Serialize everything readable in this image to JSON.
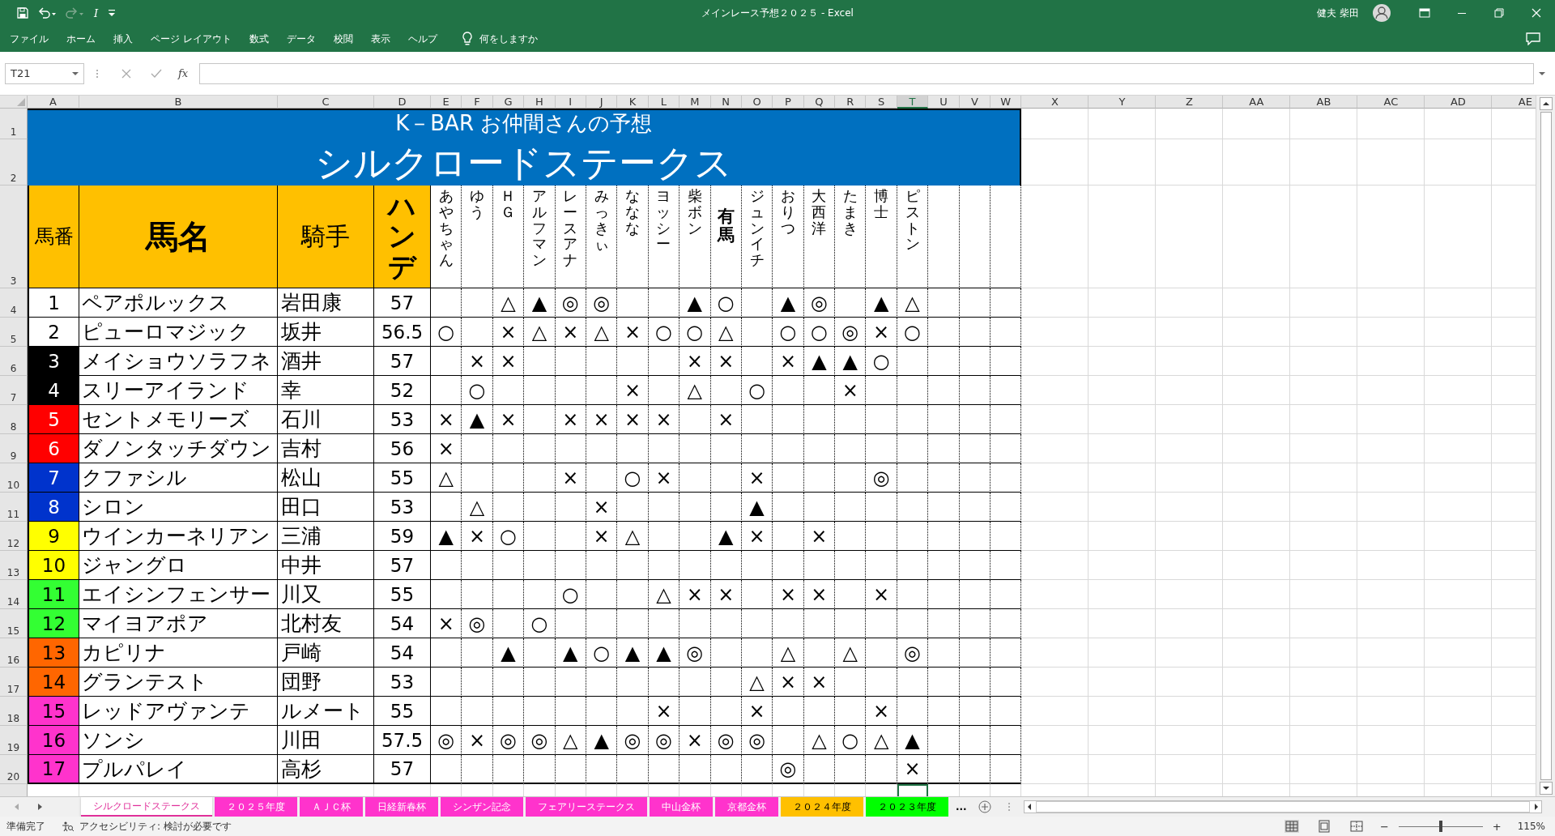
{
  "title_bar": {
    "quick_access": [
      {
        "kind": "save",
        "disabled": false
      },
      {
        "kind": "undo",
        "disabled": false
      },
      {
        "kind": "redo",
        "disabled": true
      },
      {
        "kind": "italic",
        "label": "I",
        "disabled": false
      },
      {
        "kind": "customize",
        "disabled": false
      }
    ],
    "title": "メインレース予想２０２５  -  Excel",
    "user": "健夫 柴田"
  },
  "ribbon_tabs": [
    "ファイル",
    "ホーム",
    "挿入",
    "ページ レイアウト",
    "数式",
    "データ",
    "校閲",
    "表示",
    "ヘルプ"
  ],
  "tell_me": "何をしますか",
  "formula_bar": {
    "name_box": "T21",
    "function_label": "fx"
  },
  "columns": [
    {
      "label": "A",
      "selected": false
    },
    {
      "label": "B",
      "selected": false
    },
    {
      "label": "C",
      "selected": false
    },
    {
      "label": "D",
      "selected": false
    },
    {
      "label": "E",
      "selected": false
    },
    {
      "label": "F",
      "selected": false
    },
    {
      "label": "G",
      "selected": false
    },
    {
      "label": "H",
      "selected": false
    },
    {
      "label": "I",
      "selected": false
    },
    {
      "label": "J",
      "selected": false
    },
    {
      "label": "K",
      "selected": false
    },
    {
      "label": "L",
      "selected": false
    },
    {
      "label": "M",
      "selected": false
    },
    {
      "label": "N",
      "selected": false
    },
    {
      "label": "O",
      "selected": false
    },
    {
      "label": "P",
      "selected": false
    },
    {
      "label": "Q",
      "selected": false
    },
    {
      "label": "R",
      "selected": false
    },
    {
      "label": "S",
      "selected": false
    },
    {
      "label": "T",
      "selected": true
    },
    {
      "label": "U",
      "selected": false
    },
    {
      "label": "V",
      "selected": false
    },
    {
      "label": "W",
      "selected": false
    },
    {
      "label": "X",
      "selected": false
    },
    {
      "label": "Y",
      "selected": false
    },
    {
      "label": "Z",
      "selected": false
    },
    {
      "label": "AA",
      "selected": false
    },
    {
      "label": "AB",
      "selected": false
    },
    {
      "label": "AC",
      "selected": false
    },
    {
      "label": "AD",
      "selected": false
    },
    {
      "label": "AE",
      "selected": false
    }
  ],
  "row_headers": [
    "1",
    "2",
    "3",
    "4",
    "5",
    "6",
    "7",
    "8",
    "9",
    "10",
    "11",
    "12",
    "13",
    "14",
    "15",
    "16",
    "17",
    "18",
    "19",
    "20"
  ],
  "sheet": {
    "subtitle": "K－BAR  お仲間さんの予想",
    "title": "シルクロードステークス",
    "headers": [
      "馬番",
      "馬名",
      "騎手",
      "ハンデ"
    ],
    "forecasters": [
      {
        "name": "あやちゃん",
        "bold": false
      },
      {
        "name": "ゆう",
        "bold": false
      },
      {
        "name": "ＨＧ",
        "bold": false
      },
      {
        "name": "アルフマン",
        "bold": false
      },
      {
        "name": "レースアナ",
        "bold": false
      },
      {
        "name": "みっきぃ",
        "bold": false
      },
      {
        "name": "ななな",
        "bold": false
      },
      {
        "name": "ヨッシー",
        "bold": false
      },
      {
        "name": "柴ボン",
        "bold": false
      },
      {
        "name": "有馬",
        "bold": true
      },
      {
        "name": "ジュンイチ",
        "bold": false
      },
      {
        "name": "おりつ",
        "bold": false
      },
      {
        "name": "大西洋",
        "bold": false
      },
      {
        "name": "たまき",
        "bold": false
      },
      {
        "name": "博士",
        "bold": false
      },
      {
        "name": "ピストン",
        "bold": false
      }
    ],
    "rows": [
      {
        "number": "1",
        "color": "#ffffff",
        "name": "ペアポルックス",
        "jockey": "岩田康",
        "weight": "57",
        "marks": [
          {
            "kind": "empty"
          },
          {
            "kind": "empty"
          },
          {
            "kind": "mark",
            "text": "△"
          },
          {
            "kind": "mark",
            "text": "▲"
          },
          {
            "kind": "mark",
            "text": "◎"
          },
          {
            "kind": "mark",
            "text": "◎"
          },
          {
            "kind": "empty"
          },
          {
            "kind": "empty"
          },
          {
            "kind": "mark",
            "text": "▲"
          },
          {
            "kind": "mark",
            "text": "○"
          },
          {
            "kind": "empty"
          },
          {
            "kind": "mark",
            "text": "▲"
          },
          {
            "kind": "mark",
            "text": "◎"
          },
          {
            "kind": "empty"
          },
          {
            "kind": "mark",
            "text": "▲"
          },
          {
            "kind": "mark",
            "text": "△"
          }
        ]
      },
      {
        "number": "2",
        "color": "#ffffff",
        "name": "ピューロマジック",
        "jockey": "坂井",
        "weight": "56.5",
        "marks": [
          {
            "kind": "mark",
            "text": "○"
          },
          {
            "kind": "empty"
          },
          {
            "kind": "mark",
            "text": "×"
          },
          {
            "kind": "mark",
            "text": "△"
          },
          {
            "kind": "mark",
            "text": "×"
          },
          {
            "kind": "mark",
            "text": "△"
          },
          {
            "kind": "mark",
            "text": "×"
          },
          {
            "kind": "mark",
            "text": "○"
          },
          {
            "kind": "mark",
            "text": "○"
          },
          {
            "kind": "mark",
            "text": "△"
          },
          {
            "kind": "empty"
          },
          {
            "kind": "mark",
            "text": "○"
          },
          {
            "kind": "mark",
            "text": "○"
          },
          {
            "kind": "mark",
            "text": "◎"
          },
          {
            "kind": "mark",
            "text": "×"
          },
          {
            "kind": "mark",
            "text": "○"
          }
        ]
      },
      {
        "number": "3",
        "color": "#000000",
        "name": "メイショウソラフネ",
        "jockey": "酒井",
        "weight": "57",
        "marks": [
          {
            "kind": "empty"
          },
          {
            "kind": "mark",
            "text": "×"
          },
          {
            "kind": "mark",
            "text": "×"
          },
          {
            "kind": "empty"
          },
          {
            "kind": "empty"
          },
          {
            "kind": "empty"
          },
          {
            "kind": "empty"
          },
          {
            "kind": "empty"
          },
          {
            "kind": "mark",
            "text": "×"
          },
          {
            "kind": "mark",
            "text": "×"
          },
          {
            "kind": "empty"
          },
          {
            "kind": "mark",
            "text": "×"
          },
          {
            "kind": "mark",
            "text": "▲"
          },
          {
            "kind": "mark",
            "text": "▲"
          },
          {
            "kind": "mark",
            "text": "○"
          },
          {
            "kind": "empty"
          }
        ]
      },
      {
        "number": "4",
        "color": "#000000",
        "name": "スリーアイランド",
        "jockey": "幸",
        "weight": "52",
        "marks": [
          {
            "kind": "empty"
          },
          {
            "kind": "mark",
            "text": "○"
          },
          {
            "kind": "empty"
          },
          {
            "kind": "empty"
          },
          {
            "kind": "empty"
          },
          {
            "kind": "empty"
          },
          {
            "kind": "mark",
            "text": "×"
          },
          {
            "kind": "empty"
          },
          {
            "kind": "mark",
            "text": "△"
          },
          {
            "kind": "empty"
          },
          {
            "kind": "mark",
            "text": "○"
          },
          {
            "kind": "empty"
          },
          {
            "kind": "empty"
          },
          {
            "kind": "mark",
            "text": "×"
          },
          {
            "kind": "empty"
          },
          {
            "kind": "empty"
          }
        ]
      },
      {
        "number": "5",
        "color": "#ff0000",
        "name": "セントメモリーズ",
        "jockey": "石川",
        "weight": "53",
        "marks": [
          {
            "kind": "mark",
            "text": "×"
          },
          {
            "kind": "mark",
            "text": "▲"
          },
          {
            "kind": "mark",
            "text": "×"
          },
          {
            "kind": "empty"
          },
          {
            "kind": "mark",
            "text": "×"
          },
          {
            "kind": "mark",
            "text": "×"
          },
          {
            "kind": "mark",
            "text": "×"
          },
          {
            "kind": "mark",
            "text": "×"
          },
          {
            "kind": "empty"
          },
          {
            "kind": "mark",
            "text": "×"
          },
          {
            "kind": "empty"
          },
          {
            "kind": "empty"
          },
          {
            "kind": "empty"
          },
          {
            "kind": "empty"
          },
          {
            "kind": "empty"
          },
          {
            "kind": "empty"
          }
        ]
      },
      {
        "number": "6",
        "color": "#ff0000",
        "name": "ダノンタッチダウン",
        "jockey": "吉村",
        "weight": "56",
        "marks": [
          {
            "kind": "mark",
            "text": "×"
          },
          {
            "kind": "empty"
          },
          {
            "kind": "empty"
          },
          {
            "kind": "empty"
          },
          {
            "kind": "empty"
          },
          {
            "kind": "empty"
          },
          {
            "kind": "empty"
          },
          {
            "kind": "empty"
          },
          {
            "kind": "empty"
          },
          {
            "kind": "empty"
          },
          {
            "kind": "empty"
          },
          {
            "kind": "empty"
          },
          {
            "kind": "empty"
          },
          {
            "kind": "empty"
          },
          {
            "kind": "empty"
          },
          {
            "kind": "empty"
          }
        ]
      },
      {
        "number": "7",
        "color": "#0033cc",
        "name": "クファシル",
        "jockey": "松山",
        "weight": "55",
        "marks": [
          {
            "kind": "mark",
            "text": "△"
          },
          {
            "kind": "empty"
          },
          {
            "kind": "empty"
          },
          {
            "kind": "empty"
          },
          {
            "kind": "mark",
            "text": "×"
          },
          {
            "kind": "empty"
          },
          {
            "kind": "mark",
            "text": "○"
          },
          {
            "kind": "mark",
            "text": "×"
          },
          {
            "kind": "empty"
          },
          {
            "kind": "empty"
          },
          {
            "kind": "mark",
            "text": "×"
          },
          {
            "kind": "empty"
          },
          {
            "kind": "empty"
          },
          {
            "kind": "empty"
          },
          {
            "kind": "mark",
            "text": "◎"
          },
          {
            "kind": "empty"
          }
        ]
      },
      {
        "number": "8",
        "color": "#0033cc",
        "name": "シロン",
        "jockey": "田口",
        "weight": "53",
        "marks": [
          {
            "kind": "empty"
          },
          {
            "kind": "mark",
            "text": "△"
          },
          {
            "kind": "empty"
          },
          {
            "kind": "empty"
          },
          {
            "kind": "empty"
          },
          {
            "kind": "mark",
            "text": "×"
          },
          {
            "kind": "empty"
          },
          {
            "kind": "empty"
          },
          {
            "kind": "empty"
          },
          {
            "kind": "empty"
          },
          {
            "kind": "mark",
            "text": "▲"
          },
          {
            "kind": "empty"
          },
          {
            "kind": "empty"
          },
          {
            "kind": "empty"
          },
          {
            "kind": "empty"
          },
          {
            "kind": "empty"
          }
        ]
      },
      {
        "number": "9",
        "color": "#ffff00",
        "name": "ウインカーネリアン",
        "jockey": "三浦",
        "weight": "59",
        "marks": [
          {
            "kind": "mark",
            "text": "▲"
          },
          {
            "kind": "mark",
            "text": "×"
          },
          {
            "kind": "mark",
            "text": "○"
          },
          {
            "kind": "empty"
          },
          {
            "kind": "empty"
          },
          {
            "kind": "mark",
            "text": "×"
          },
          {
            "kind": "mark",
            "text": "△"
          },
          {
            "kind": "empty"
          },
          {
            "kind": "empty"
          },
          {
            "kind": "mark",
            "text": "▲"
          },
          {
            "kind": "mark",
            "text": "×"
          },
          {
            "kind": "empty"
          },
          {
            "kind": "mark",
            "text": "×"
          },
          {
            "kind": "empty"
          },
          {
            "kind": "empty"
          },
          {
            "kind": "empty"
          }
        ]
      },
      {
        "number": "10",
        "color": "#ffff00",
        "name": "ジャングロ",
        "jockey": "中井",
        "weight": "57",
        "marks": [
          {
            "kind": "empty"
          },
          {
            "kind": "empty"
          },
          {
            "kind": "empty"
          },
          {
            "kind": "empty"
          },
          {
            "kind": "empty"
          },
          {
            "kind": "empty"
          },
          {
            "kind": "empty"
          },
          {
            "kind": "empty"
          },
          {
            "kind": "empty"
          },
          {
            "kind": "empty"
          },
          {
            "kind": "empty"
          },
          {
            "kind": "empty"
          },
          {
            "kind": "empty"
          },
          {
            "kind": "empty"
          },
          {
            "kind": "empty"
          },
          {
            "kind": "empty"
          }
        ]
      },
      {
        "number": "11",
        "color": "#33ff33",
        "name": "エイシンフェンサー",
        "jockey": "川又",
        "weight": "55",
        "marks": [
          {
            "kind": "empty"
          },
          {
            "kind": "empty"
          },
          {
            "kind": "empty"
          },
          {
            "kind": "empty"
          },
          {
            "kind": "mark",
            "text": "○"
          },
          {
            "kind": "empty"
          },
          {
            "kind": "empty"
          },
          {
            "kind": "mark",
            "text": "△"
          },
          {
            "kind": "mark",
            "text": "×"
          },
          {
            "kind": "mark",
            "text": "×"
          },
          {
            "kind": "empty"
          },
          {
            "kind": "mark",
            "text": "×"
          },
          {
            "kind": "mark",
            "text": "×"
          },
          {
            "kind": "empty"
          },
          {
            "kind": "mark",
            "text": "×"
          },
          {
            "kind": "empty"
          }
        ]
      },
      {
        "number": "12",
        "color": "#33ff33",
        "name": "マイヨアポア",
        "jockey": "北村友",
        "weight": "54",
        "marks": [
          {
            "kind": "mark",
            "text": "×"
          },
          {
            "kind": "mark",
            "text": "◎"
          },
          {
            "kind": "empty"
          },
          {
            "kind": "mark",
            "text": "○"
          },
          {
            "kind": "empty"
          },
          {
            "kind": "empty"
          },
          {
            "kind": "empty"
          },
          {
            "kind": "empty"
          },
          {
            "kind": "empty"
          },
          {
            "kind": "empty"
          },
          {
            "kind": "empty"
          },
          {
            "kind": "empty"
          },
          {
            "kind": "empty"
          },
          {
            "kind": "empty"
          },
          {
            "kind": "empty"
          },
          {
            "kind": "empty"
          }
        ]
      },
      {
        "number": "13",
        "color": "#ff6600",
        "name": "カピリナ",
        "jockey": "戸崎",
        "weight": "54",
        "marks": [
          {
            "kind": "empty"
          },
          {
            "kind": "empty"
          },
          {
            "kind": "mark",
            "text": "▲"
          },
          {
            "kind": "empty"
          },
          {
            "kind": "mark",
            "text": "▲"
          },
          {
            "kind": "mark",
            "text": "○"
          },
          {
            "kind": "mark",
            "text": "▲"
          },
          {
            "kind": "mark",
            "text": "▲"
          },
          {
            "kind": "mark",
            "text": "◎"
          },
          {
            "kind": "empty"
          },
          {
            "kind": "empty"
          },
          {
            "kind": "mark",
            "text": "△"
          },
          {
            "kind": "empty"
          },
          {
            "kind": "mark",
            "text": "△"
          },
          {
            "kind": "empty"
          },
          {
            "kind": "mark",
            "text": "◎"
          }
        ]
      },
      {
        "number": "14",
        "color": "#ff6600",
        "name": "グランテスト",
        "jockey": "団野",
        "weight": "53",
        "marks": [
          {
            "kind": "empty"
          },
          {
            "kind": "empty"
          },
          {
            "kind": "empty"
          },
          {
            "kind": "empty"
          },
          {
            "kind": "empty"
          },
          {
            "kind": "empty"
          },
          {
            "kind": "empty"
          },
          {
            "kind": "empty"
          },
          {
            "kind": "empty"
          },
          {
            "kind": "empty"
          },
          {
            "kind": "mark",
            "text": "△"
          },
          {
            "kind": "mark",
            "text": "×"
          },
          {
            "kind": "mark",
            "text": "×"
          },
          {
            "kind": "empty"
          },
          {
            "kind": "empty"
          },
          {
            "kind": "empty"
          }
        ]
      },
      {
        "number": "15",
        "color": "#ff33cc",
        "name": "レッドアヴァンテ",
        "jockey": "ルメート",
        "weight": "55",
        "marks": [
          {
            "kind": "empty"
          },
          {
            "kind": "empty"
          },
          {
            "kind": "empty"
          },
          {
            "kind": "empty"
          },
          {
            "kind": "empty"
          },
          {
            "kind": "empty"
          },
          {
            "kind": "empty"
          },
          {
            "kind": "mark",
            "text": "×"
          },
          {
            "kind": "empty"
          },
          {
            "kind": "empty"
          },
          {
            "kind": "mark",
            "text": "×"
          },
          {
            "kind": "empty"
          },
          {
            "kind": "empty"
          },
          {
            "kind": "empty"
          },
          {
            "kind": "mark",
            "text": "×"
          },
          {
            "kind": "empty"
          }
        ]
      },
      {
        "number": "16",
        "color": "#ff33cc",
        "name": "ソンシ",
        "jockey": "川田",
        "weight": "57.5",
        "marks": [
          {
            "kind": "mark",
            "text": "◎"
          },
          {
            "kind": "mark",
            "text": "×"
          },
          {
            "kind": "mark",
            "text": "◎"
          },
          {
            "kind": "mark",
            "text": "◎"
          },
          {
            "kind": "mark",
            "text": "△"
          },
          {
            "kind": "mark",
            "text": "▲"
          },
          {
            "kind": "mark",
            "text": "◎"
          },
          {
            "kind": "mark",
            "text": "◎"
          },
          {
            "kind": "mark",
            "text": "×"
          },
          {
            "kind": "mark",
            "text": "◎"
          },
          {
            "kind": "mark",
            "text": "◎"
          },
          {
            "kind": "empty"
          },
          {
            "kind": "mark",
            "text": "△"
          },
          {
            "kind": "mark",
            "text": "○"
          },
          {
            "kind": "mark",
            "text": "△"
          },
          {
            "kind": "mark",
            "text": "▲"
          }
        ]
      },
      {
        "number": "17",
        "color": "#ff33cc",
        "name": "プルパレイ",
        "jockey": "高杉",
        "weight": "57",
        "marks": [
          {
            "kind": "empty"
          },
          {
            "kind": "empty"
          },
          {
            "kind": "empty"
          },
          {
            "kind": "empty"
          },
          {
            "kind": "empty"
          },
          {
            "kind": "empty"
          },
          {
            "kind": "empty"
          },
          {
            "kind": "empty"
          },
          {
            "kind": "empty"
          },
          {
            "kind": "empty"
          },
          {
            "kind": "empty"
          },
          {
            "kind": "mark",
            "text": "◎"
          },
          {
            "kind": "empty"
          },
          {
            "kind": "empty"
          },
          {
            "kind": "empty"
          },
          {
            "kind": "mark",
            "text": "×"
          }
        ]
      }
    ]
  },
  "sheet_tabs": [
    {
      "label": "シルクロードステークス",
      "selected": true,
      "color": "#e0309a"
    },
    {
      "label": "２０２５年度",
      "selected": false,
      "color": "#ff33cc"
    },
    {
      "label": "ＡＪＣ杯",
      "selected": false,
      "color": "#ff33cc"
    },
    {
      "label": "日経新春杯",
      "selected": false,
      "color": "#ff33cc"
    },
    {
      "label": "シンザン記念",
      "selected": false,
      "color": "#ff33cc"
    },
    {
      "label": "フェアリーステークス",
      "selected": false,
      "color": "#ff33cc"
    },
    {
      "label": "中山金杯",
      "selected": false,
      "color": "#ff33cc"
    },
    {
      "label": "京都金杯",
      "selected": false,
      "color": "#ff33cc"
    },
    {
      "label": "２０２４年度",
      "selected": false,
      "color": "#ffc000"
    },
    {
      "label": "２０２３年度",
      "selected": false,
      "color": "#00ff00"
    }
  ],
  "more_tabs": "...",
  "status_bar": {
    "ready": "準備完了",
    "accessibility": "アクセシビリティ: 検討が必要です",
    "views": [
      {
        "kind": "normal",
        "selected": true
      },
      {
        "kind": "page_layout",
        "selected": false
      },
      {
        "kind": "page_break",
        "selected": false
      }
    ],
    "zoom_out": "−",
    "zoom_in": "+",
    "zoom": {
      "level": 0.5
    },
    "zoom_label": "115%"
  }
}
